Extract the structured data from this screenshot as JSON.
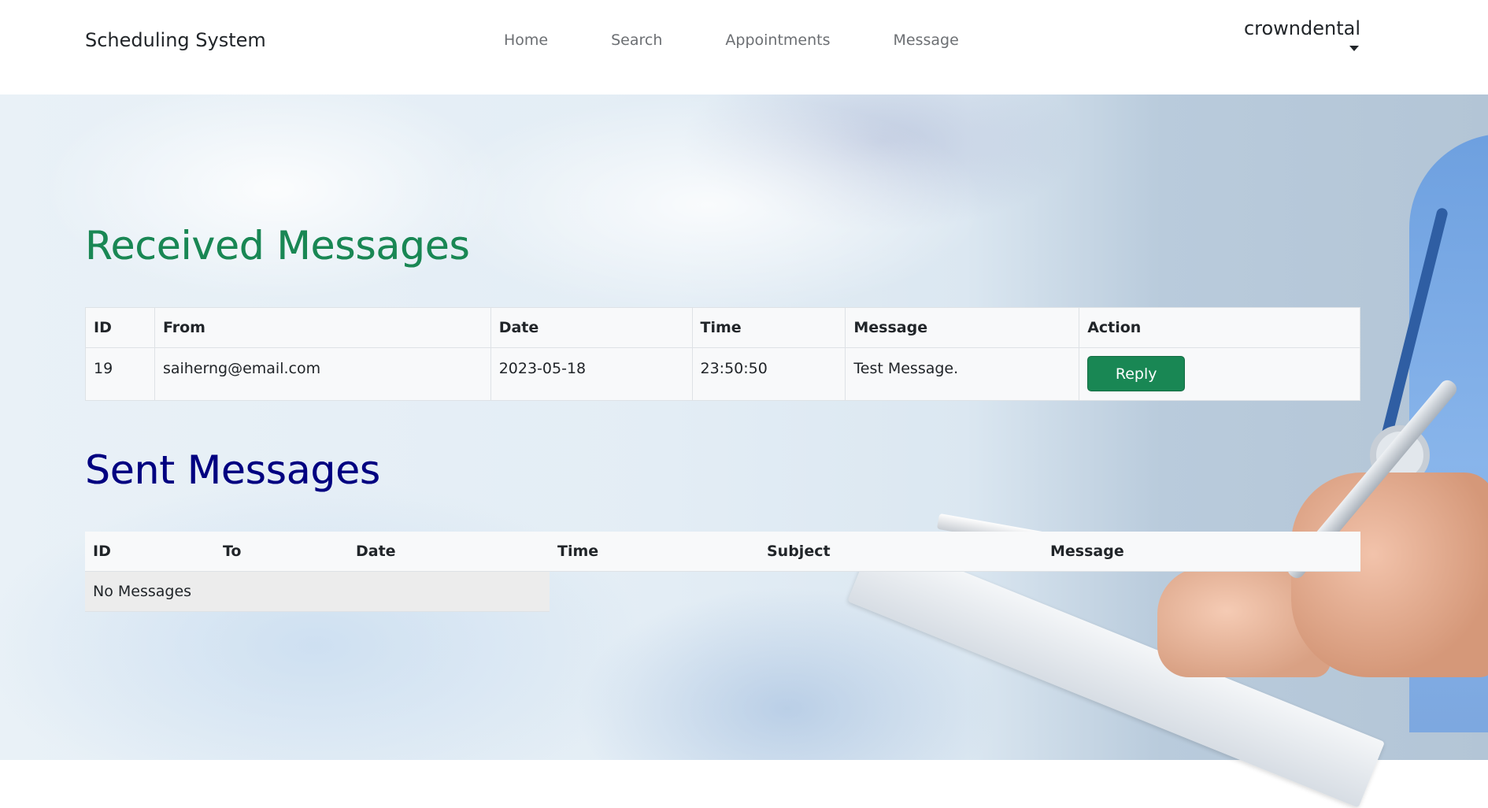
{
  "navbar": {
    "brand": "Scheduling System",
    "links": [
      "Home",
      "Search",
      "Appointments",
      "Message"
    ],
    "user": "crowndental"
  },
  "received": {
    "title": "Received Messages",
    "columns": [
      "ID",
      "From",
      "Date",
      "Time",
      "Message",
      "Action"
    ],
    "rows": [
      {
        "id": "19",
        "from": "saiherng@email.com",
        "date": "2023-05-18",
        "time": "23:50:50",
        "message": "Test Message.",
        "action": "Reply"
      }
    ]
  },
  "sent": {
    "title": "Sent Messages",
    "columns": [
      "ID",
      "To",
      "Date",
      "Time",
      "Subject",
      "Message"
    ],
    "empty_text": "No Messages"
  },
  "colors": {
    "received_title": "#198754",
    "sent_title": "#000080",
    "reply_button": "#198754"
  }
}
